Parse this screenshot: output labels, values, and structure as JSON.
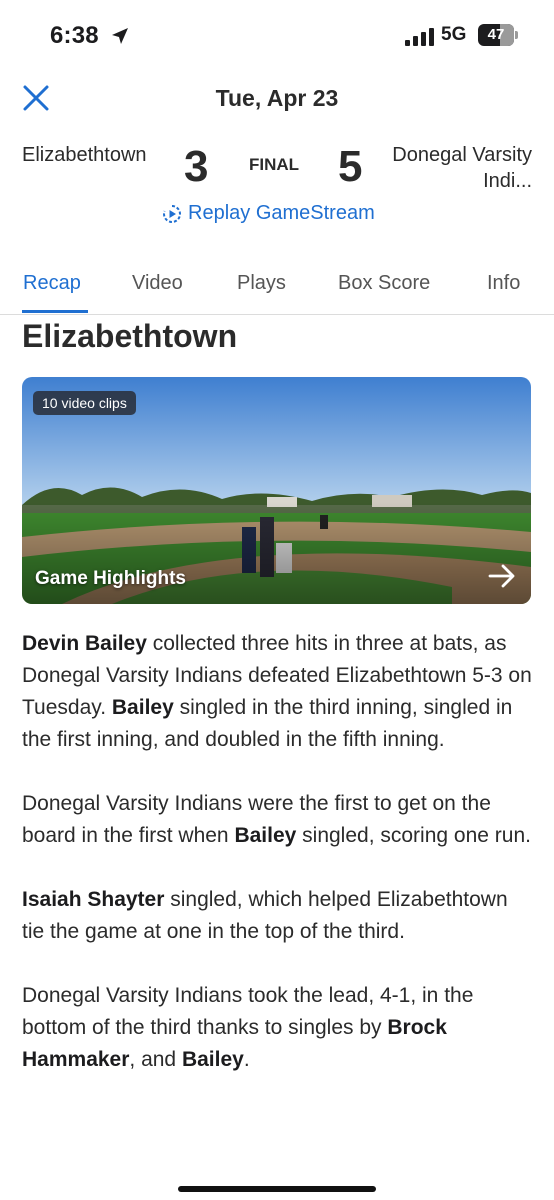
{
  "status_bar": {
    "time": "6:38",
    "network": "5G",
    "battery": "47"
  },
  "header": {
    "date": "Tue, Apr 23"
  },
  "score": {
    "home_team": "Elizabethtown",
    "home_score": "3",
    "status": "FINAL",
    "away_score": "5",
    "away_team": "Donegal Varsity Indi..."
  },
  "replay_label": "Replay GameStream",
  "tabs": [
    {
      "label": "Recap"
    },
    {
      "label": "Video"
    },
    {
      "label": "Plays"
    },
    {
      "label": "Box Score"
    },
    {
      "label": "Info"
    }
  ],
  "section_title": "Elizabethtown",
  "video": {
    "badge": "10 video clips",
    "title": "Game Highlights"
  },
  "article": [
    {
      "b1": "Devin Bailey",
      "t1": " collected three hits in three at bats, as Donegal Varsity Indians defeated Elizabethtown 5-3 on Tuesday. ",
      "b2": "Bailey",
      "t2": " singled in the third inning, singled in the first inning, and doubled in the fifth inning."
    },
    {
      "t1": "Donegal Varsity Indians were the first to get on the board in the first when ",
      "b1": "Bailey",
      "t2": " singled, scoring one run."
    },
    {
      "b1": "Isaiah Shayter",
      "t1": " singled, which helped Elizabethtown tie the game at one in the top of the third."
    },
    {
      "t1": "Donegal Varsity Indians took the lead, 4-1, in the bottom of the third thanks to singles by ",
      "b1": "Brock Hammaker",
      "t2": ", and ",
      "b2": "Bailey",
      "t3": "."
    }
  ],
  "colors": {
    "accent": "#1f6fd1",
    "text": "#2b2b2b"
  }
}
